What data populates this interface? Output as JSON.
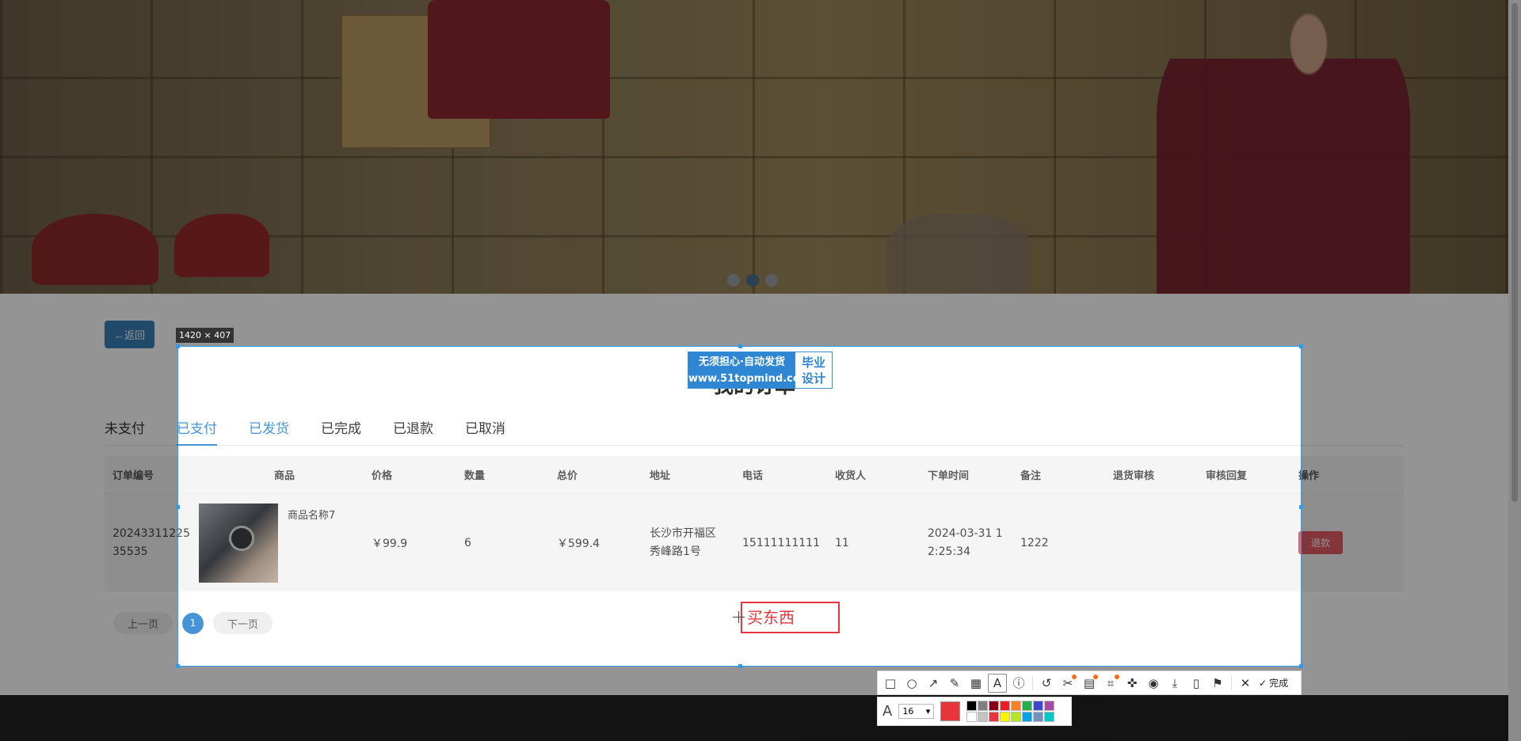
{
  "back_label": "←返回",
  "page_title": "我的订单",
  "tabs": [
    {
      "label": "未支付",
      "state": "normal"
    },
    {
      "label": "已支付",
      "state": "active"
    },
    {
      "label": "已发货",
      "state": "blue"
    },
    {
      "label": "已完成",
      "state": "normal"
    },
    {
      "label": "已退款",
      "state": "normal"
    },
    {
      "label": "已取消",
      "state": "normal"
    }
  ],
  "table": {
    "headers": {
      "order_no": "订单编号",
      "goods": "商品",
      "price": "价格",
      "qty": "数量",
      "total": "总价",
      "address": "地址",
      "phone": "电话",
      "receiver": "收货人",
      "time": "下单时间",
      "note": "备注",
      "return_audit": "退货审核",
      "audit_reply": "审核回复",
      "ops": "操作"
    },
    "rows": [
      {
        "order_no_line1": "20243311225",
        "order_no_line2": "35535",
        "goods_name": "商品名称7",
        "goods_image": "wristwatch-photo",
        "price": "￥99.9",
        "qty": "6",
        "total": "￥599.4",
        "address_line1": "长沙市开福区",
        "address_line2": "秀峰路1号",
        "phone": "15111111111",
        "receiver": "11",
        "time_line1": "2024-03-31 1",
        "time_line2": "2:25:34",
        "note": "1222",
        "return_audit": "",
        "audit_reply": "",
        "action": "退款"
      }
    ]
  },
  "pager": {
    "prev": "上一页",
    "current": "1",
    "next": "下一页"
  },
  "screenshot_tool": {
    "size_label": "1420 × 407",
    "watermark": {
      "line1": "无须担心·自动发货",
      "url": "www.51topmind.com",
      "right1": "毕业",
      "right2": "设计"
    },
    "annotation_text": "买东西",
    "done_label": "完成",
    "font_size": "16",
    "current_color": "#e8353b",
    "palette": [
      "#000000",
      "#7f7f7f",
      "#880015",
      "#ed1c24",
      "#ff7f27",
      "#22b14c",
      "#3f48cc",
      "#a349a4",
      "#ffffff",
      "#c3c3c3",
      "#e8353b",
      "#fff200",
      "#b5e61d",
      "#00a2e8",
      "#7092be",
      "#00c8c8"
    ],
    "tools": [
      "rectangle-icon",
      "ellipse-icon",
      "arrow-icon",
      "pen-icon",
      "mosaic-icon",
      "text-icon",
      "number-icon",
      "undo-icon",
      "cut-icon",
      "ocr-icon",
      "scan-icon",
      "pin-icon",
      "record-icon",
      "save-icon",
      "phone-icon",
      "bookmark-icon",
      "close-icon"
    ]
  }
}
